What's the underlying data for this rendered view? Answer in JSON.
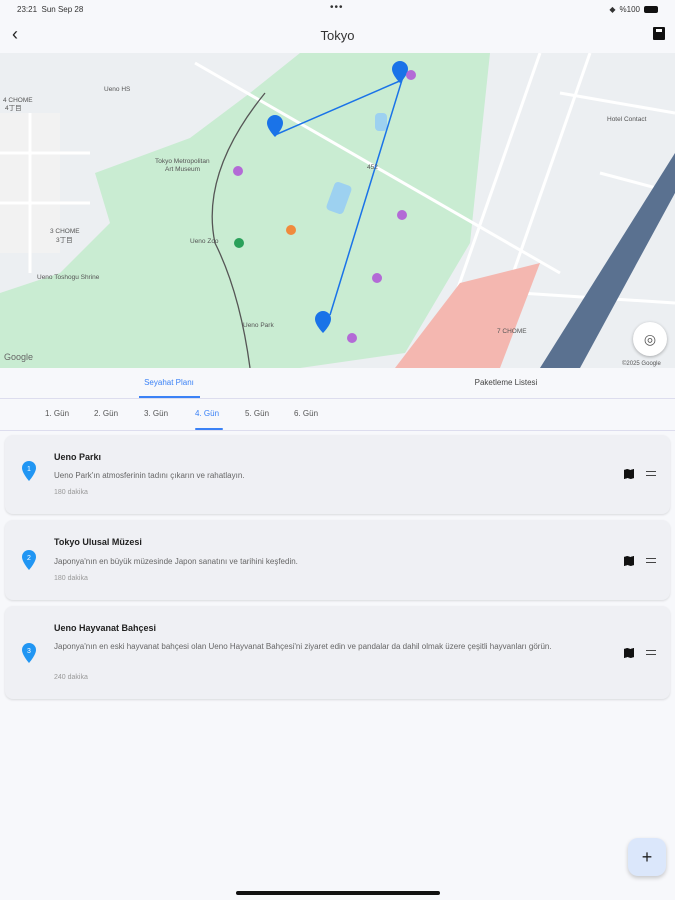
{
  "status": {
    "time": "23:21",
    "date": "Sun Sep 28",
    "battery": "%100"
  },
  "header": {
    "title": "Tokyo"
  },
  "map": {
    "labels": {
      "ueno_hs": "Ueno HS",
      "chome4": "4 CHOME",
      "chome4jp": "4丁目",
      "art": "Tokyo Metropolitan",
      "art2": "Art Museum",
      "zoo": "Ueno Zoo",
      "chome3": "3 CHOME",
      "chome3jp": "3丁目",
      "shrine": "Ueno Toshogu Shrine",
      "park": "Ueno Park",
      "hotel": "Hotel Contact",
      "chome7": "7 CHOME",
      "road": "452"
    },
    "logo": "Google",
    "copyright": "©2025 Google",
    "accent": "#1a73e8"
  },
  "tabs": [
    {
      "label": "Seyahat Planı",
      "active": true
    },
    {
      "label": "Paketleme Listesi",
      "active": false
    }
  ],
  "days": [
    "1. Gün",
    "2. Gün",
    "3. Gün",
    "4. Gün",
    "5. Gün",
    "6. Gün"
  ],
  "active_day": 3,
  "items": [
    {
      "num": "1",
      "name": "Ueno Parkı",
      "desc": "Ueno Park'ın atmosferinin tadını çıkarın ve rahatlayın.",
      "duration": "180 dakika"
    },
    {
      "num": "2",
      "name": "Tokyo Ulusal Müzesi",
      "desc": "Japonya'nın en büyük müzesinde Japon sanatını ve tarihini keşfedin.",
      "duration": "180 dakika"
    },
    {
      "num": "3",
      "name": "Ueno Hayvanat Bahçesi",
      "desc": "Japonya'nın en eski hayvanat bahçesi olan Ueno Hayvanat Bahçesi'ni ziyaret edin ve pandalar da dahil olmak üzere çeşitli hayvanları görün.",
      "duration": "240 dakika"
    }
  ],
  "fab": "+"
}
